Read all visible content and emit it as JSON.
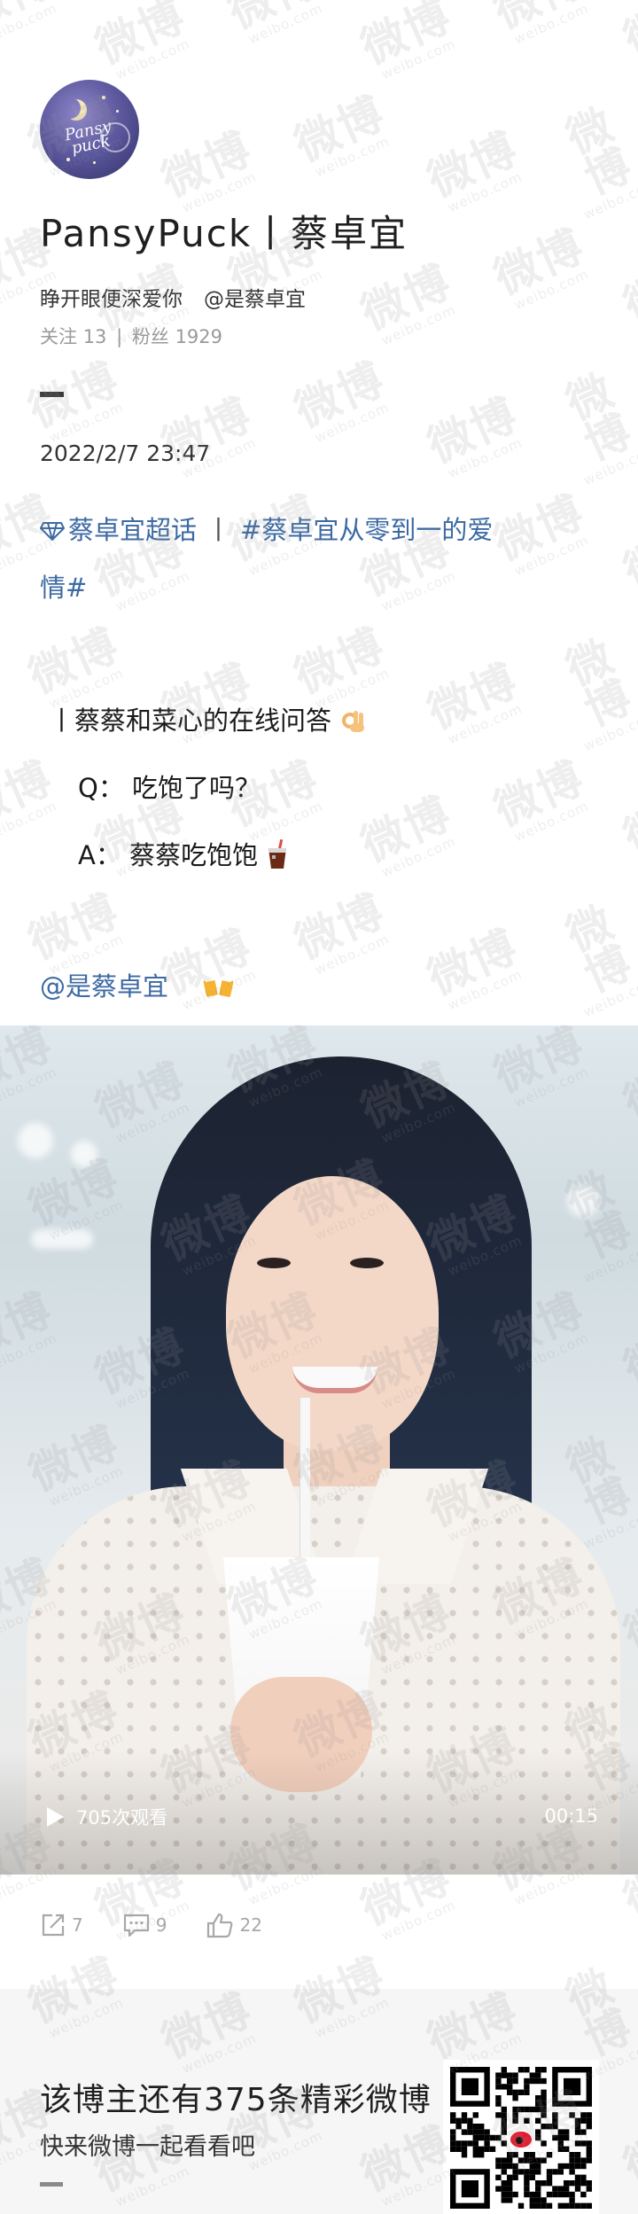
{
  "profile": {
    "avatar_text": "Pansy puck",
    "name": "PansyPuck丨蔡卓宜",
    "bio": "睁开眼便深爱你",
    "bio_handle": "@是蔡卓宜",
    "following_label": "关注",
    "following_count": "13",
    "followers_label": "粉丝",
    "followers_count": "1929"
  },
  "post": {
    "time": "2022/2/7  23:47",
    "supertopic": "蔡卓宜超话",
    "separator": "丨",
    "hashtag_part1": "#蔡卓宜从零到一的爱",
    "hashtag_part2": "情#",
    "qa_title": "丨蔡蔡和菜心的在线问答",
    "question_label": "Q：",
    "question": "吃饱了吗？",
    "answer_label": "A：",
    "answer": "蔡蔡吃饱饱",
    "mention": "@是蔡卓宜"
  },
  "video": {
    "views": "705次观看",
    "duration": "00:15"
  },
  "actions": {
    "repost_count": "7",
    "comment_count": "9",
    "like_count": "22"
  },
  "footer": {
    "title": "该博主还有375条精彩微博",
    "subtitle": "快来微博一起看看吧"
  },
  "watermark": {
    "brand": "微博",
    "domain": "weibo.com"
  },
  "colors": {
    "link": "#3d6aa3",
    "text": "#1f1f1f",
    "muted": "#9a9a9a",
    "footer_bg": "#f6f6f6"
  },
  "icons": [
    "diamond-icon",
    "ok-hand-emoji",
    "drink-emoji",
    "beer-mugs-emoji",
    "play-icon",
    "repost-icon",
    "comment-icon",
    "like-icon",
    "qr-code",
    "weibo-logo"
  ]
}
